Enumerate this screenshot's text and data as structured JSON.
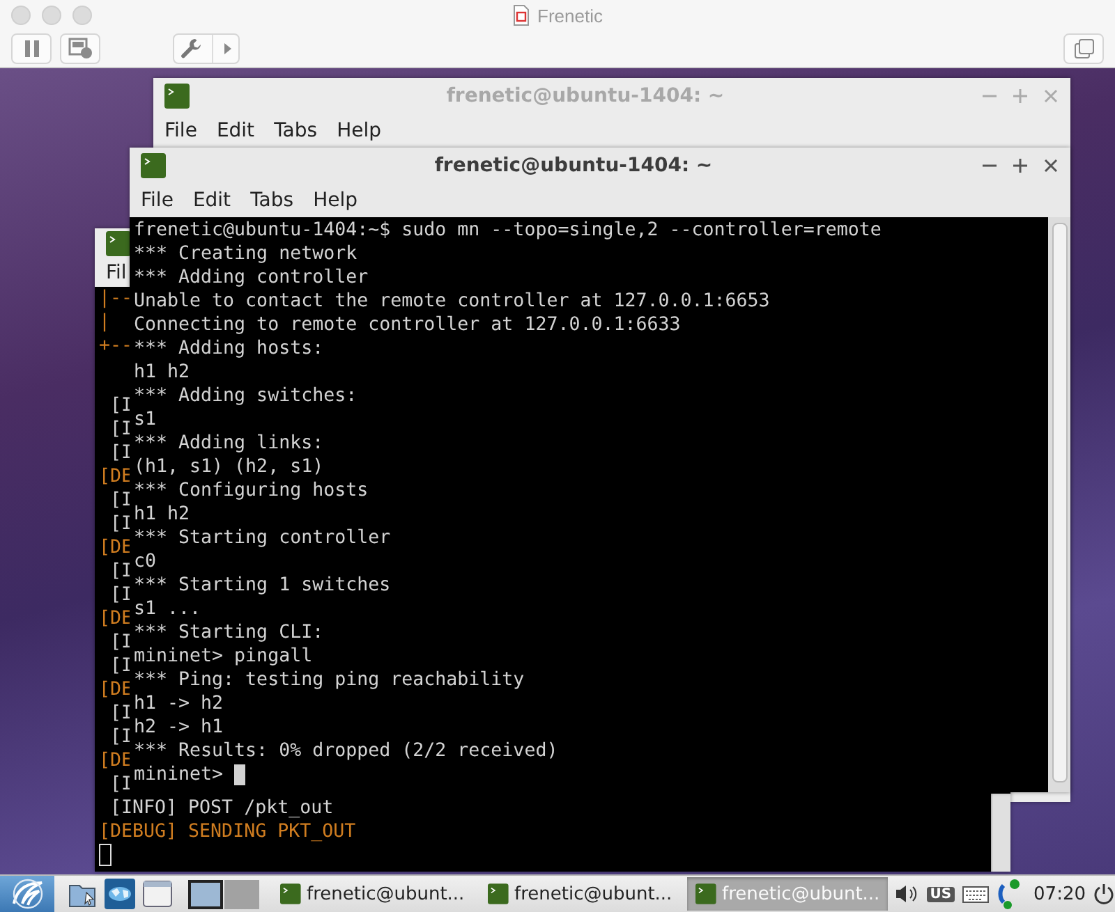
{
  "vm_window": {
    "title": "Frenetic"
  },
  "back_terminal": {
    "title": "frenetic@ubuntu-1404: ~",
    "focused": false,
    "menu": [
      "File",
      "Edit",
      "Tabs",
      "Help"
    ]
  },
  "left_terminal": {
    "menu": [
      "Fil"
    ],
    "header_lines": [
      "|--",
      "|",
      "+--"
    ],
    "log_lines": [
      {
        "text": "[I",
        "kind": "info"
      },
      {
        "text": "[I",
        "kind": "info"
      },
      {
        "text": "[I",
        "kind": "info"
      },
      {
        "text": "[DE",
        "kind": "debug"
      },
      {
        "text": "[I",
        "kind": "info"
      },
      {
        "text": "[I",
        "kind": "info"
      },
      {
        "text": "[DE",
        "kind": "debug"
      },
      {
        "text": "[I",
        "kind": "info"
      },
      {
        "text": "[I",
        "kind": "info"
      },
      {
        "text": "[DE",
        "kind": "debug"
      },
      {
        "text": "[I",
        "kind": "info"
      },
      {
        "text": "[I",
        "kind": "info"
      },
      {
        "text": "[DE",
        "kind": "debug"
      },
      {
        "text": "[I",
        "kind": "info"
      },
      {
        "text": "[I",
        "kind": "info"
      },
      {
        "text": "[DE",
        "kind": "debug"
      },
      {
        "text": "[I",
        "kind": "info"
      },
      {
        "text": "[INFO] POST /pkt_out",
        "kind": "info"
      },
      {
        "text": "[DEBUG] SENDING PKT_OUT",
        "kind": "debug"
      }
    ],
    "cursor": true
  },
  "front_terminal": {
    "title": "frenetic@ubuntu-1404: ~",
    "focused": true,
    "menu": [
      "File",
      "Edit",
      "Tabs",
      "Help"
    ],
    "lines": [
      "frenetic@ubuntu-1404:~$ sudo mn --topo=single,2 --controller=remote",
      "*** Creating network",
      "*** Adding controller",
      "Unable to contact the remote controller at 127.0.0.1:6653",
      "Connecting to remote controller at 127.0.0.1:6633",
      "*** Adding hosts:",
      "h1 h2",
      "*** Adding switches:",
      "s1",
      "*** Adding links:",
      "(h1, s1) (h2, s1)",
      "*** Configuring hosts",
      "h1 h2",
      "*** Starting controller",
      "c0",
      "*** Starting 1 switches",
      "s1 ...",
      "*** Starting CLI:",
      "mininet> pingall",
      "*** Ping: testing ping reachability",
      "h1 -> h2",
      "h2 -> h1",
      "*** Results: 0% dropped (2/2 received)"
    ],
    "prompt": "mininet>",
    "cursor": true
  },
  "taskbar": {
    "workspaces": [
      {
        "selected": true
      },
      {
        "selected": false
      }
    ],
    "tasks": [
      {
        "label": "frenetic@ubunt...",
        "selected": false
      },
      {
        "label": "frenetic@ubunt...",
        "selected": false
      },
      {
        "label": "frenetic@ubunt...",
        "selected": true
      }
    ],
    "keyboard_layout": "US",
    "clock": "07:20"
  }
}
